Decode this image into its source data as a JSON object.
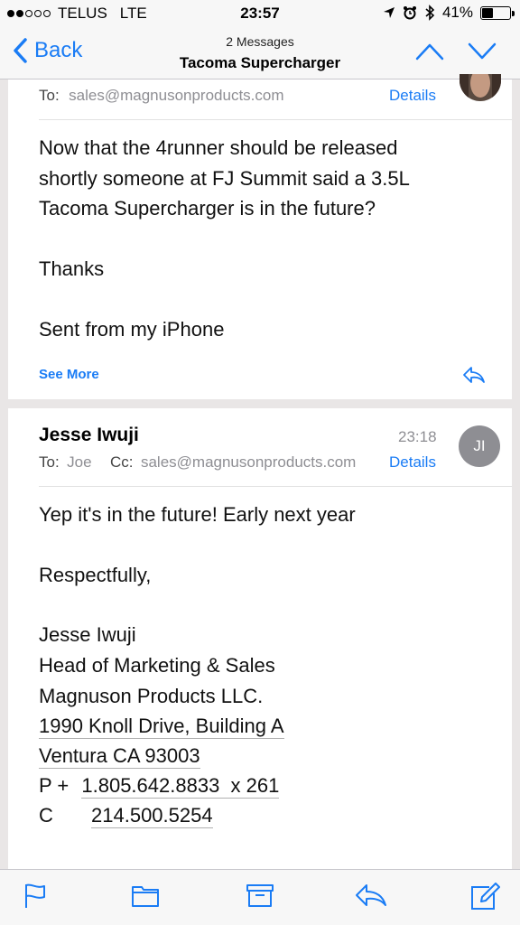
{
  "status": {
    "carrier": "TELUS",
    "network": "LTE",
    "time": "23:57",
    "battery": "41%",
    "signal_bars": 2
  },
  "nav": {
    "back_label": "Back",
    "subtitle": "2 Messages",
    "title": "Tacoma Supercharger"
  },
  "message1": {
    "to_label": "To:",
    "to_value": "sales@magnusonproducts.com",
    "details_label": "Details",
    "body": [
      "Now that the 4runner should be released",
      "shortly someone at FJ Summit said a 3.5L",
      "Tacoma Supercharger is in the future?",
      "Thanks",
      "Sent from my iPhone"
    ],
    "see_more": "See More"
  },
  "message2": {
    "sender": "Jesse Iwuji",
    "time": "23:18",
    "avatar_initials": "JI",
    "to_label": "To:",
    "to_value": "Joe",
    "cc_label": "Cc:",
    "cc_value": "sales@magnusonproducts.com",
    "details_label": "Details",
    "body_line1": "Yep it's in the future! Early next year",
    "closing": "Respectfully,",
    "sig_name": "Jesse Iwuji",
    "sig_title": "Head of Marketing & Sales",
    "sig_company": "Magnuson Products LLC.",
    "sig_address1": "1990 Knoll Drive, Building A",
    "sig_address2": "Ventura CA 93003",
    "phone_label": "P +",
    "phone_value": "1.805.642.8833  x 261",
    "cell_label": "C",
    "cell_value": "214.500.5254"
  },
  "colors": {
    "accent": "#1a7cf5",
    "gray": "#8e8e93"
  },
  "icons": [
    "flag-icon",
    "folder-icon",
    "archive-icon",
    "reply-icon",
    "compose-icon"
  ]
}
